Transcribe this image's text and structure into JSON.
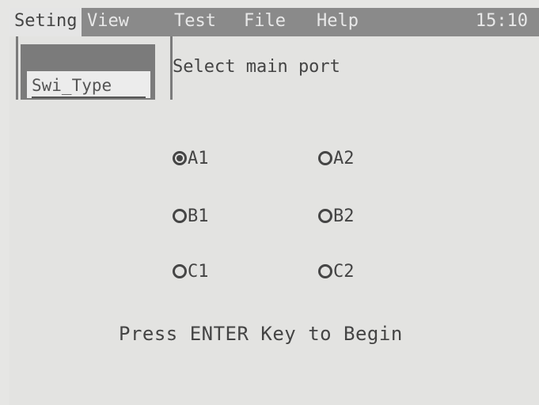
{
  "menubar": {
    "items": [
      {
        "label": "Seting",
        "active": true
      },
      {
        "label": "View",
        "active": false
      },
      {
        "label": "Test",
        "active": false
      },
      {
        "label": "File",
        "active": false
      },
      {
        "label": "Help",
        "active": false
      }
    ],
    "clock": "15:10"
  },
  "subtab": {
    "label": "Swi_Type"
  },
  "prompt": "Select main port",
  "ports": [
    {
      "label": "A1",
      "selected": true
    },
    {
      "label": "A2",
      "selected": false
    },
    {
      "label": "B1",
      "selected": false
    },
    {
      "label": "B2",
      "selected": false
    },
    {
      "label": "C1",
      "selected": false
    },
    {
      "label": "C2",
      "selected": false
    }
  ],
  "footer": "Press ENTER Key to Begin",
  "colors": {
    "menubar_bg": "#8a8a8a",
    "screen_bg": "#e3e3e1",
    "text": "#444444"
  }
}
